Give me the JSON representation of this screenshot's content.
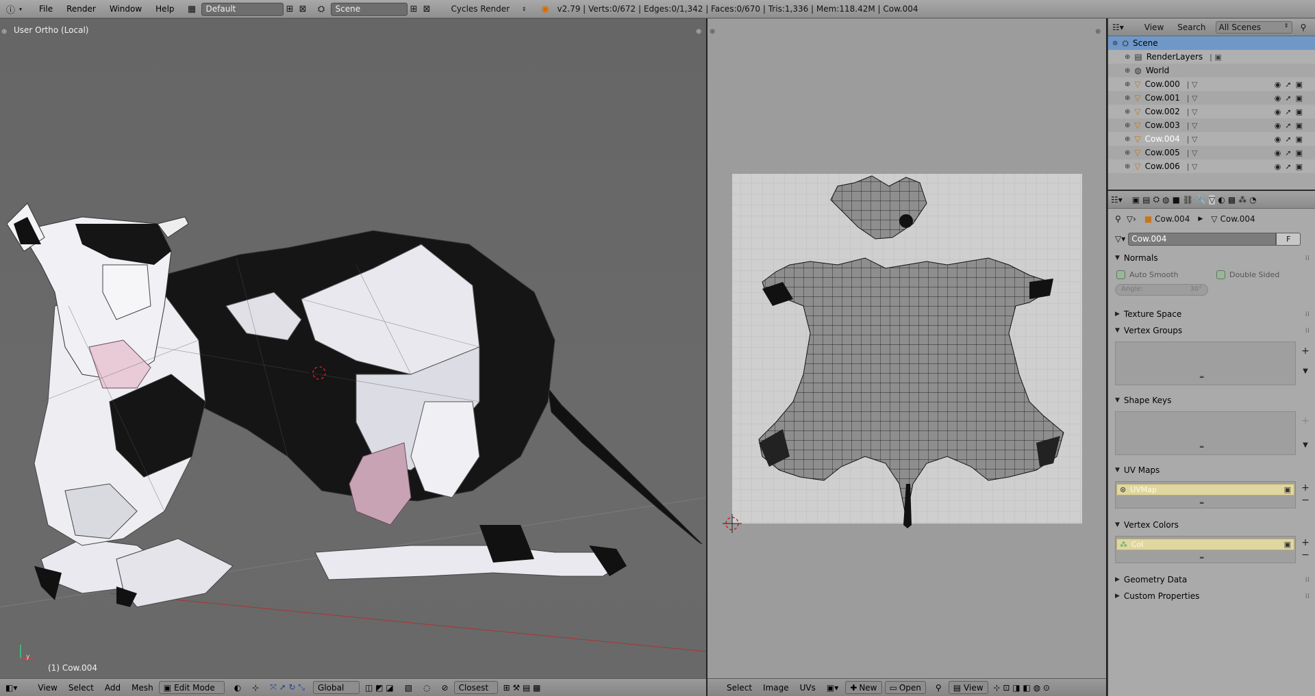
{
  "topbar": {
    "menus": [
      "File",
      "Render",
      "Window",
      "Help"
    ],
    "layout": "Default",
    "scene": "Scene",
    "engine": "Cycles Render",
    "stats": "v2.79 | Verts:0/672 | Edges:0/1,342 | Faces:0/670 | Tris:1,336 | Mem:118.42M | Cow.004"
  },
  "viewport": {
    "title": "User Ortho (Local)",
    "object_label": "(1) Cow.004",
    "header": {
      "menus": [
        "View",
        "Select",
        "Add",
        "Mesh"
      ],
      "mode": "Edit Mode",
      "orientation": "Global",
      "snap": "Closest"
    }
  },
  "image_editor": {
    "header": {
      "menus": [
        "Select",
        "Image",
        "UVs"
      ],
      "new_label": "New",
      "open_label": "Open",
      "view_label": "View"
    }
  },
  "outliner": {
    "header": {
      "view": "View",
      "search": "Search",
      "scope": "All Scenes"
    },
    "rows": [
      {
        "label": "Scene",
        "indent": 0,
        "kind": "scene",
        "selected": true
      },
      {
        "label": "RenderLayers",
        "indent": 1,
        "kind": "renderlayers"
      },
      {
        "label": "World",
        "indent": 1,
        "kind": "world"
      },
      {
        "label": "Cow.000",
        "indent": 1,
        "kind": "mesh"
      },
      {
        "label": "Cow.001",
        "indent": 1,
        "kind": "mesh"
      },
      {
        "label": "Cow.002",
        "indent": 1,
        "kind": "mesh"
      },
      {
        "label": "Cow.003",
        "indent": 1,
        "kind": "mesh"
      },
      {
        "label": "Cow.004",
        "indent": 1,
        "kind": "mesh",
        "active": true
      },
      {
        "label": "Cow.005",
        "indent": 1,
        "kind": "mesh"
      },
      {
        "label": "Cow.006",
        "indent": 1,
        "kind": "mesh"
      }
    ]
  },
  "properties": {
    "breadcrumb": [
      "Cow.004",
      "Cow.004"
    ],
    "datablock_name": "Cow.004",
    "datablock_fake": "F",
    "normals": {
      "title": "Normals",
      "auto_smooth": "Auto Smooth",
      "double_sided": "Double Sided",
      "angle_label": "Angle:",
      "angle_value": "30°"
    },
    "texture_space": "Texture Space",
    "vertex_groups": "Vertex Groups",
    "shape_keys": "Shape Keys",
    "uv_maps": {
      "title": "UV Maps",
      "item": "UVMap"
    },
    "vertex_colors": {
      "title": "Vertex Colors",
      "item": "Col"
    },
    "geometry_data": "Geometry Data",
    "custom_properties": "Custom Properties"
  },
  "colors": {
    "selection_blue": "#6f98c9",
    "active_white": "#ffffff",
    "highlight_yellow": "#e0d7a0",
    "uv_face_gray": "#8f8f8f"
  }
}
